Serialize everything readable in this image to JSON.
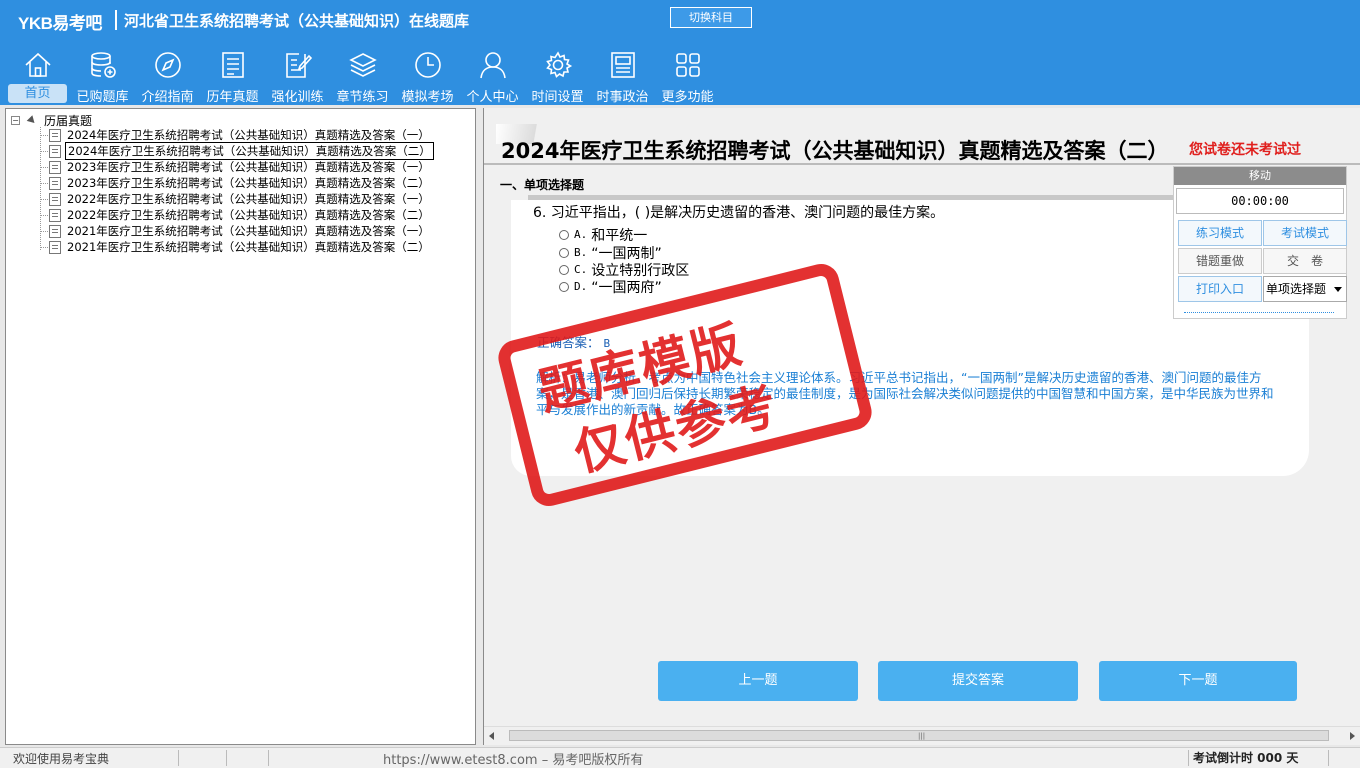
{
  "header": {
    "logo": "YKB易考吧",
    "title": "河北省卫生系统招聘考试（公共基础知识）在线题库",
    "switch_label": "切换科目"
  },
  "nav": [
    {
      "label": "首页",
      "icon": "home-icon"
    },
    {
      "label": "已购题库",
      "icon": "database-icon"
    },
    {
      "label": "介绍指南",
      "icon": "compass-icon"
    },
    {
      "label": "历年真题",
      "icon": "list-document-icon"
    },
    {
      "label": "强化训练",
      "icon": "edit-icon"
    },
    {
      "label": "章节练习",
      "icon": "layers-icon"
    },
    {
      "label": "模拟考场",
      "icon": "clock-icon"
    },
    {
      "label": "个人中心",
      "icon": "user-icon"
    },
    {
      "label": "时间设置",
      "icon": "gear-icon"
    },
    {
      "label": "时事政治",
      "icon": "newspaper-icon"
    },
    {
      "label": "更多功能",
      "icon": "grid-icon"
    }
  ],
  "tree": {
    "root": "历届真题",
    "items": [
      "2024年医疗卫生系统招聘考试（公共基础知识）真题精选及答案（一）",
      "2024年医疗卫生系统招聘考试（公共基础知识）真题精选及答案（二）",
      "2023年医疗卫生系统招聘考试（公共基础知识）真题精选及答案（一）",
      "2023年医疗卫生系统招聘考试（公共基础知识）真题精选及答案（二）",
      "2022年医疗卫生系统招聘考试（公共基础知识）真题精选及答案（一）",
      "2022年医疗卫生系统招聘考试（公共基础知识）真题精选及答案（二）",
      "2021年医疗卫生系统招聘考试（公共基础知识）真题精选及答案（一）",
      "2021年医疗卫生系统招聘考试（公共基础知识）真题精选及答案（二）"
    ],
    "selected_index": 1
  },
  "main": {
    "title": "2024年医疗卫生系统招聘考试（公共基础知识）真题精选及答案（二）",
    "exam_status": "您试卷还未考试过",
    "section": "一、单项选择题",
    "question": "6. 习近平指出，( )是解决历史遗留的香港、澳门问题的最佳方案。",
    "options": [
      {
        "letter": "A.",
        "text": "和平统一"
      },
      {
        "letter": "B.",
        "text": "“一国两制”"
      },
      {
        "letter": "C.",
        "text": "设立特别行政区"
      },
      {
        "letter": "D.",
        "text": "“一国两府”"
      }
    ],
    "answer_label": "正确答案：",
    "answer_value": "B",
    "explanation": "解析：易老师分析，考点为中国特色社会主义理论体系。习近平总书记指出，“一国两制”是解决历史遗留的香港、澳门问题的最佳方案，是香港、澳门回归后保持长期繁荣稳定的最佳制度，是为国际社会解决类似问题提供的中国智慧和中国方案，是中华民族为世界和平与发展作出的新贡献。故正确答案为B。",
    "prev_label": "上一题",
    "submit_label": "提交答案",
    "next_label": "下一题"
  },
  "watermark": {
    "line1": "题库模版",
    "line2": "仅供参考"
  },
  "float_panel": {
    "move_label": "移动",
    "timer": "00:00:00",
    "practice_mode": "练习模式",
    "exam_mode": "考试模式",
    "wrong_redo": "错题重做",
    "hand_in": "交　卷",
    "print": "打印入口",
    "type_select": "单项选择题"
  },
  "status": {
    "left": "欢迎使用易考宝典",
    "middle": "https://www.etest8.com – 易考吧版权所有",
    "right": "考试倒计时 000 天"
  },
  "colors": {
    "header_blue": "#2f8fe0",
    "button_blue": "#4ab0f0",
    "stamp_red": "#e01b1b",
    "status_red": "#e0201e"
  }
}
